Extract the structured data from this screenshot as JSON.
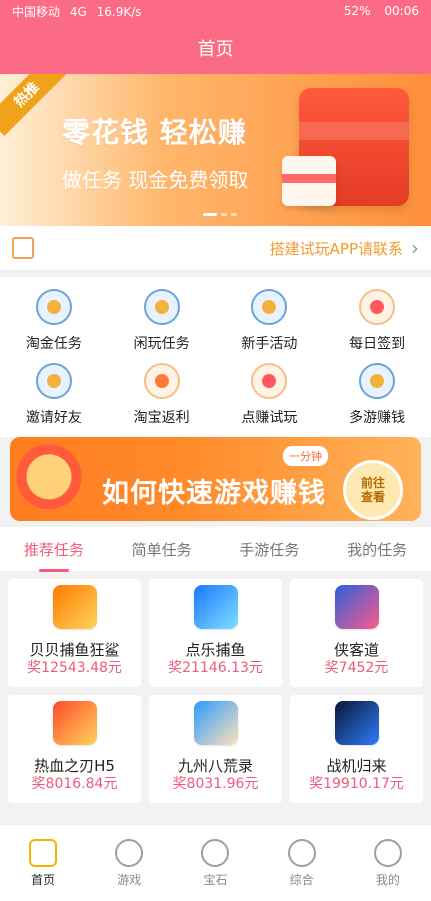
{
  "status": {
    "carrier": "中国移动",
    "network": "4G",
    "speed": "16.9K/s",
    "battery": "52%",
    "time": "00:06"
  },
  "header": {
    "title": "首页"
  },
  "banner": {
    "tag": "热推",
    "headline": "零花钱 轻松赚",
    "subline": "做任务 现金免费领取"
  },
  "notice": {
    "text": "搭建试玩APP请联系"
  },
  "quick_actions": [
    {
      "label": "淘金任务",
      "icon": "gold-task-icon"
    },
    {
      "label": "闲玩任务",
      "icon": "casual-task-icon"
    },
    {
      "label": "新手活动",
      "icon": "newbie-icon"
    },
    {
      "label": "每日签到",
      "icon": "checkin-icon"
    },
    {
      "label": "邀请好友",
      "icon": "invite-icon"
    },
    {
      "label": "淘宝返利",
      "icon": "taobao-rebate-icon"
    },
    {
      "label": "点赚试玩",
      "icon": "trial-icon"
    },
    {
      "label": "多游赚钱",
      "icon": "multi-game-icon"
    }
  ],
  "promo": {
    "badge": "一分钟",
    "title": "如何快速游戏赚钱",
    "button": "前往\n查看"
  },
  "tabs": [
    "推荐任务",
    "简单任务",
    "手游任务",
    "我的任务"
  ],
  "tasks": [
    {
      "name": "贝贝捕鱼狂鲨",
      "reward": "奖12543.48元"
    },
    {
      "name": "点乐捕鱼",
      "reward": "奖21146.13元"
    },
    {
      "name": "侠客道",
      "reward": "奖7452元"
    },
    {
      "name": "热血之刃H5",
      "reward": "奖8016.84元"
    },
    {
      "name": "九州八荒录",
      "reward": "奖8031.96元"
    },
    {
      "name": "战机归来",
      "reward": "奖19910.17元"
    }
  ],
  "bottom_nav": [
    {
      "label": "首页",
      "active": true
    },
    {
      "label": "游戏",
      "active": false
    },
    {
      "label": "宝石",
      "active": false
    },
    {
      "label": "综合",
      "active": false
    },
    {
      "label": "我的",
      "active": false
    }
  ]
}
